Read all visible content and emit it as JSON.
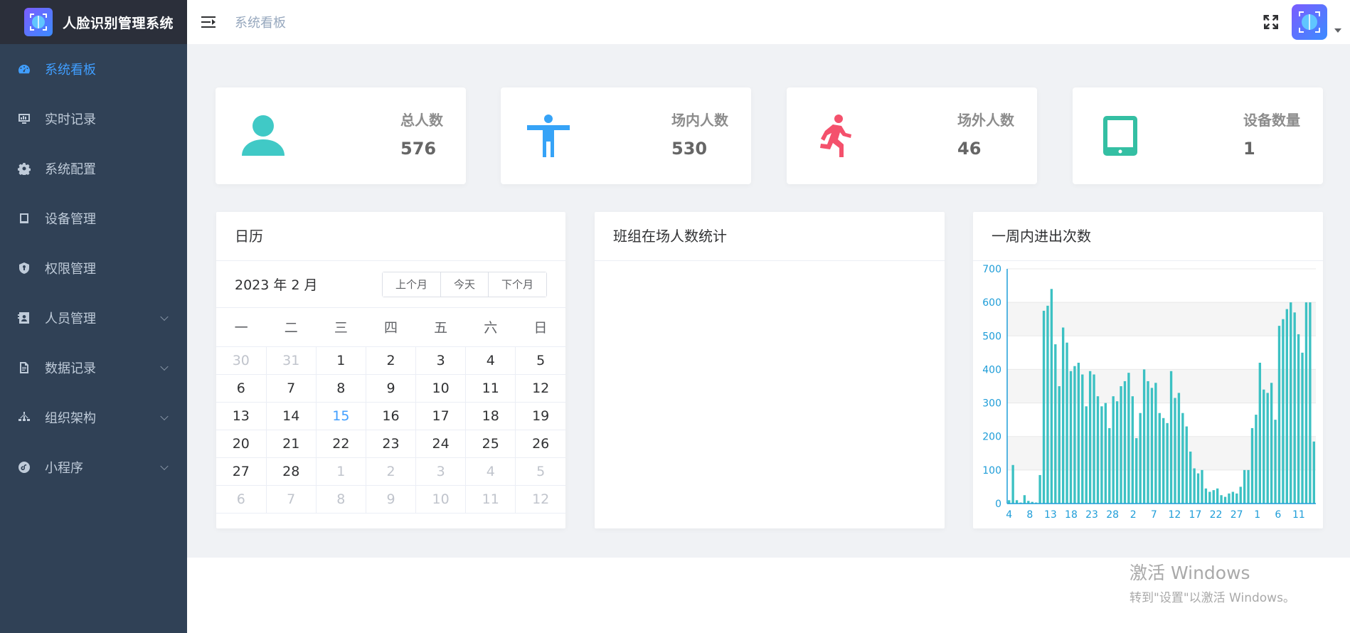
{
  "app": {
    "title": "人脸识别管理系统"
  },
  "sidebar": {
    "items": [
      {
        "label": "系统看板",
        "icon": "dashboard-icon",
        "active": true,
        "expandable": false
      },
      {
        "label": "实时记录",
        "icon": "chart-board-icon",
        "active": false,
        "expandable": false
      },
      {
        "label": "系统配置",
        "icon": "gear-icon",
        "active": false,
        "expandable": false
      },
      {
        "label": "设备管理",
        "icon": "tablet-icon",
        "active": false,
        "expandable": false
      },
      {
        "label": "权限管理",
        "icon": "shield-icon",
        "active": false,
        "expandable": false
      },
      {
        "label": "人员管理",
        "icon": "contact-card-icon",
        "active": false,
        "expandable": true
      },
      {
        "label": "数据记录",
        "icon": "document-icon",
        "active": false,
        "expandable": true
      },
      {
        "label": "组织架构",
        "icon": "org-tree-icon",
        "active": false,
        "expandable": true
      },
      {
        "label": "小程序",
        "icon": "mini-program-icon",
        "active": false,
        "expandable": true
      }
    ]
  },
  "header": {
    "breadcrumb": "系统看板"
  },
  "stats": [
    {
      "label": "总人数",
      "value": "576",
      "icon": "person-icon",
      "color": "#40c9c6"
    },
    {
      "label": "场内人数",
      "value": "530",
      "icon": "standing-person-icon",
      "color": "#36a3f7"
    },
    {
      "label": "场外人数",
      "value": "46",
      "icon": "running-person-icon",
      "color": "#f4516c"
    },
    {
      "label": "设备数量",
      "value": "1",
      "icon": "tablet-device-icon",
      "color": "#34bfa3"
    }
  ],
  "calendar": {
    "panel_title": "日历",
    "current": "2023 年 2 月",
    "buttons": {
      "prev": "上个月",
      "today": "今天",
      "next": "下个月"
    },
    "weekdays": [
      "一",
      "二",
      "三",
      "四",
      "五",
      "六",
      "日"
    ],
    "weeks": [
      [
        {
          "d": "30",
          "o": true
        },
        {
          "d": "31",
          "o": true
        },
        {
          "d": "1"
        },
        {
          "d": "2"
        },
        {
          "d": "3"
        },
        {
          "d": "4"
        },
        {
          "d": "5"
        }
      ],
      [
        {
          "d": "6"
        },
        {
          "d": "7"
        },
        {
          "d": "8"
        },
        {
          "d": "9"
        },
        {
          "d": "10"
        },
        {
          "d": "11"
        },
        {
          "d": "12"
        }
      ],
      [
        {
          "d": "13"
        },
        {
          "d": "14"
        },
        {
          "d": "15",
          "t": true
        },
        {
          "d": "16"
        },
        {
          "d": "17"
        },
        {
          "d": "18"
        },
        {
          "d": "19"
        }
      ],
      [
        {
          "d": "20"
        },
        {
          "d": "21"
        },
        {
          "d": "22"
        },
        {
          "d": "23"
        },
        {
          "d": "24"
        },
        {
          "d": "25"
        },
        {
          "d": "26"
        }
      ],
      [
        {
          "d": "27"
        },
        {
          "d": "28"
        },
        {
          "d": "1",
          "o": true
        },
        {
          "d": "2",
          "o": true
        },
        {
          "d": "3",
          "o": true
        },
        {
          "d": "4",
          "o": true
        },
        {
          "d": "5",
          "o": true
        }
      ],
      [
        {
          "d": "6",
          "o": true
        },
        {
          "d": "7",
          "o": true
        },
        {
          "d": "8",
          "o": true
        },
        {
          "d": "9",
          "o": true
        },
        {
          "d": "10",
          "o": true
        },
        {
          "d": "11",
          "o": true
        },
        {
          "d": "12",
          "o": true
        }
      ]
    ]
  },
  "team_panel": {
    "title": "班组在场人数统计"
  },
  "week_panel": {
    "title": "一周内进出次数"
  },
  "chart_data": {
    "type": "bar",
    "title": "",
    "xlabel": "",
    "ylabel": "",
    "ylim": [
      0,
      700
    ],
    "yticks": [
      0,
      100,
      200,
      300,
      400,
      500,
      600,
      700
    ],
    "xtick_labels": [
      "4",
      "8",
      "13",
      "18",
      "23",
      "28",
      "2",
      "7",
      "12",
      "17",
      "22",
      "27",
      "1",
      "6",
      "11"
    ],
    "grid": true,
    "color": "#3cc1c3",
    "series": [
      {
        "values": [
          10,
          115,
          10,
          3,
          25,
          8,
          5,
          3,
          85,
          575,
          590,
          640,
          475,
          350,
          525,
          480,
          395,
          410,
          420,
          385,
          290,
          395,
          385,
          320,
          290,
          300,
          225,
          320,
          305,
          350,
          365,
          390,
          320,
          195,
          270,
          400,
          365,
          345,
          360,
          270,
          255,
          240,
          395,
          315,
          330,
          270,
          230,
          155,
          105,
          90,
          100,
          45,
          35,
          40,
          45,
          25,
          20,
          30,
          35,
          30,
          50,
          100,
          100,
          225,
          265,
          420,
          340,
          330,
          360,
          250,
          530,
          550,
          580,
          600,
          570,
          505,
          450,
          600,
          600,
          185
        ]
      }
    ]
  },
  "watermark": {
    "line1": "激活 Windows",
    "line2": "转到\"设置\"以激活 Windows。"
  }
}
